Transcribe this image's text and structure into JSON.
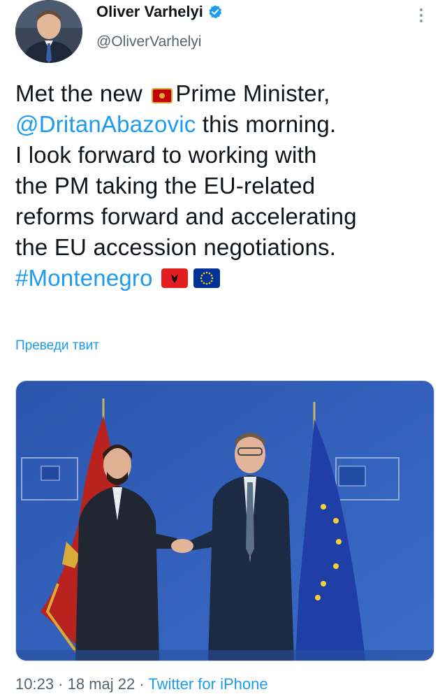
{
  "author": {
    "name": "Oliver Varhelyi",
    "handle": "@OliverVarhelyi",
    "verified": true
  },
  "tweet": {
    "line1_pre": "Met the new ",
    "line1_post": "Prime Minister,",
    "mention": "@DritanAbazovic",
    "line2_post": " this morning.",
    "line3": "I look forward to working with",
    "line4": "the PM taking the EU-related",
    "line5": "reforms forward and accelerating",
    "line6": "the EU accession negotiations.",
    "hashtag": "#Montenegro",
    "emoji": [
      "montenegro-flag",
      "albania-flag",
      "eu-flag"
    ]
  },
  "translate_label": "Преведи твит",
  "meta": {
    "time": "10:23",
    "sep1": " · ",
    "date": "18 maj 22",
    "sep2": " · ",
    "source": "Twitter for iPhone"
  },
  "colors": {
    "link": "#1d9bf0",
    "text": "#0f1419",
    "secondary": "#536471",
    "photo_background": "#2e5bb3"
  },
  "icons": [
    "verified-badge-icon",
    "more-options-icon"
  ]
}
